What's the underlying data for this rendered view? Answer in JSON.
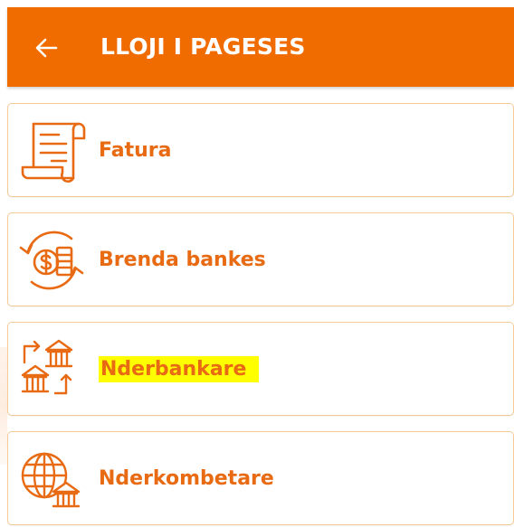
{
  "appbar": {
    "title": "LLOJI I PAGESES",
    "back_icon": "arrow-left-icon"
  },
  "colors": {
    "accent": "#f06b00",
    "label": "#e86a12",
    "border": "#f3c996",
    "highlight": "#ffff00"
  },
  "payment_types": [
    {
      "label": "Fatura",
      "icon": "invoice-icon"
    },
    {
      "label": "Brenda bankes",
      "icon": "money-exchange-icon"
    },
    {
      "label": "Nderbankare",
      "icon": "interbank-icon",
      "highlighted": true
    },
    {
      "label": "Nderkombetare",
      "icon": "globe-bank-icon"
    }
  ]
}
